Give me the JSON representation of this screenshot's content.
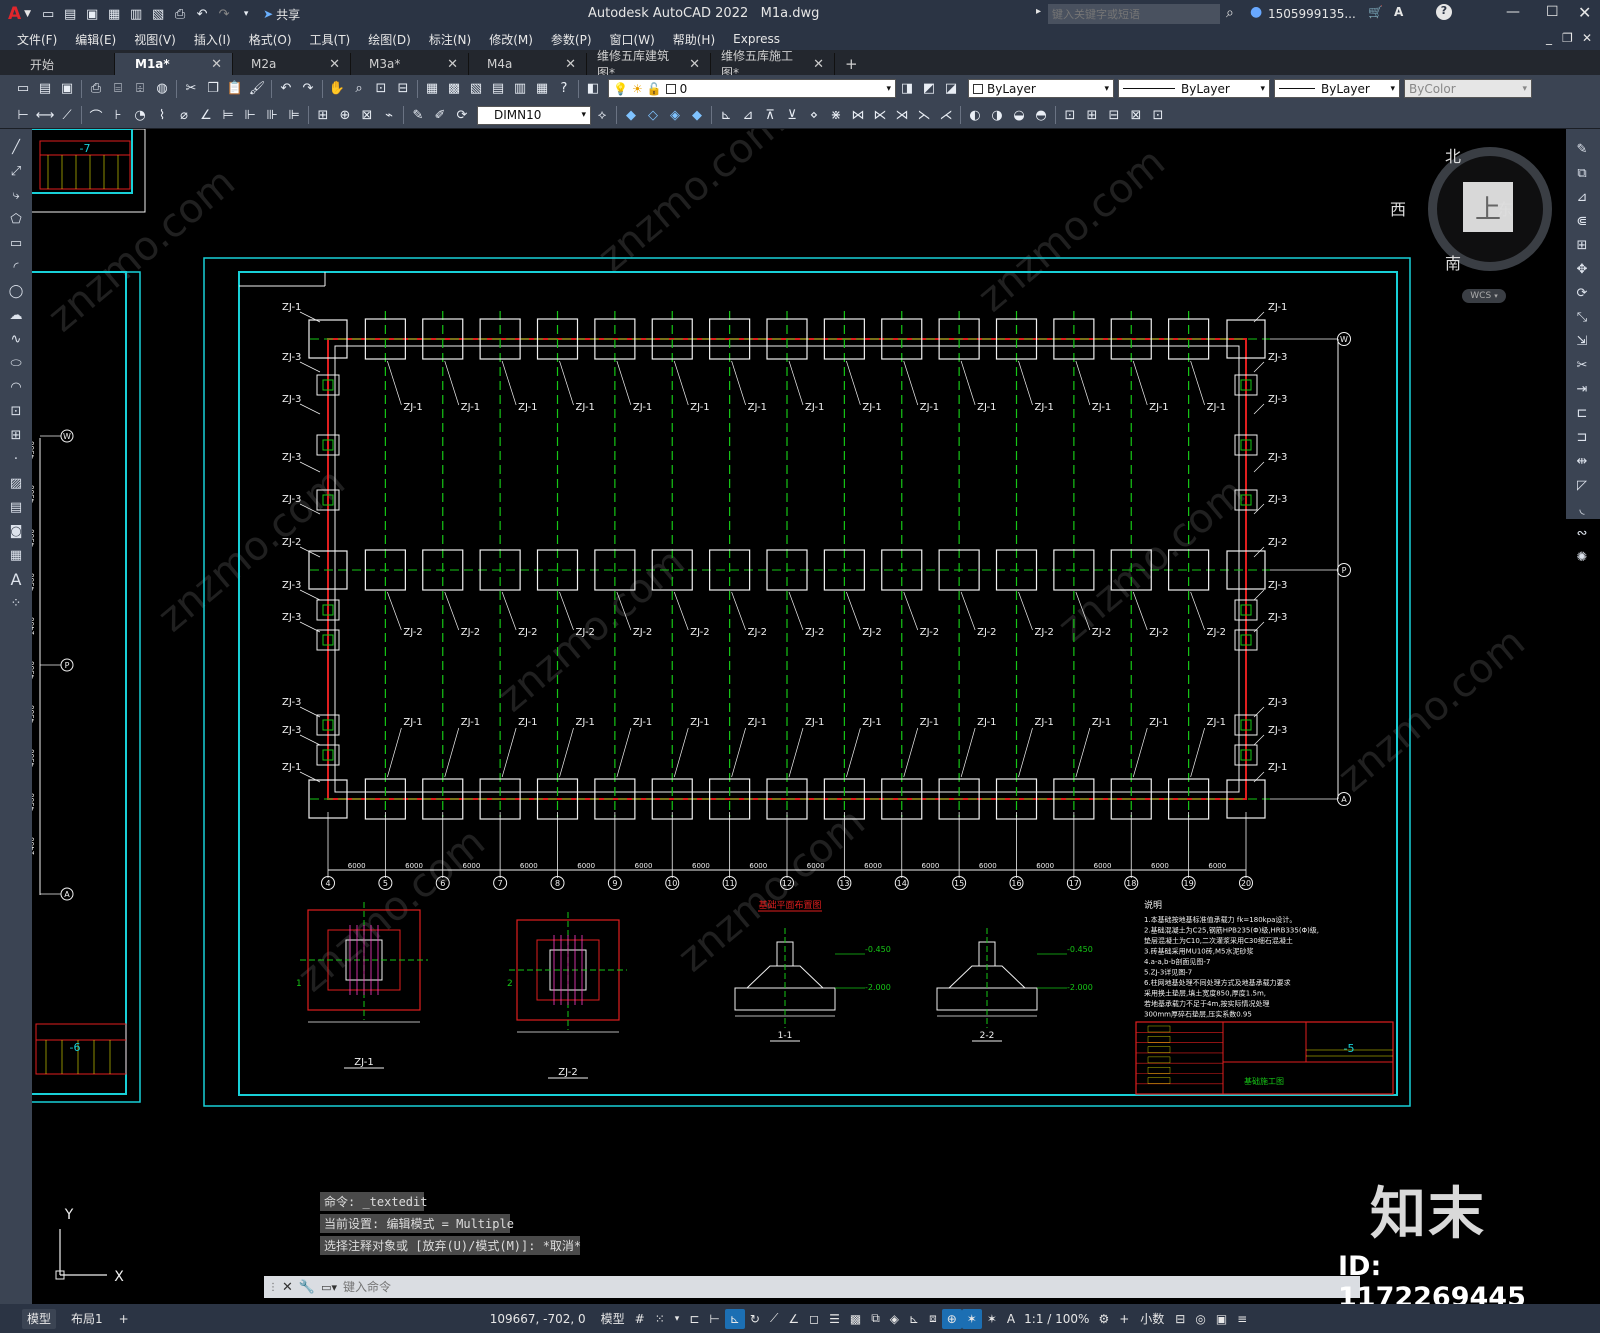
{
  "title": {
    "app": "Autodesk AutoCAD 2022",
    "file": "M1a.dwg",
    "search_placeholder": "键入关键字或短语",
    "user": "1505999135...",
    "share": "共享"
  },
  "menu": [
    "文件(F)",
    "编辑(E)",
    "视图(V)",
    "插入(I)",
    "格式(O)",
    "工具(T)",
    "绘图(D)",
    "标注(N)",
    "修改(M)",
    "参数(P)",
    "窗口(W)",
    "帮助(H)",
    "Express"
  ],
  "tabs": [
    {
      "label": "开始",
      "active": false,
      "closable": false
    },
    {
      "label": "M1a*",
      "active": true,
      "closable": true
    },
    {
      "label": "M2a",
      "active": false,
      "closable": true
    },
    {
      "label": "M3a*",
      "active": false,
      "closable": true
    },
    {
      "label": "M4a",
      "active": false,
      "closable": true
    },
    {
      "label": "维修五库建筑图*",
      "active": false,
      "closable": true
    },
    {
      "label": "维修五库施工图*",
      "active": false,
      "closable": true
    }
  ],
  "layer": {
    "current": "0",
    "color": "ByLayer",
    "linetype": "ByLayer",
    "lineweight": "ByLayer",
    "plotstyle": "ByColor",
    "dimstyle": "DIMN10"
  },
  "viewcube": {
    "north": "北",
    "south": "南",
    "east": "东",
    "west": "西",
    "face": "上",
    "wcs": "WCS"
  },
  "drawing": {
    "top_labels": [
      "ZJ-1",
      "ZJ-1",
      "ZJ-1",
      "ZJ-1",
      "ZJ-1",
      "ZJ-1",
      "ZJ-1",
      "ZJ-1",
      "ZJ-1",
      "ZJ-1",
      "ZJ-1",
      "ZJ-1",
      "ZJ-1",
      "ZJ-1",
      "ZJ-1"
    ],
    "mid_labels": [
      "ZJ-2",
      "ZJ-2",
      "ZJ-2",
      "ZJ-2",
      "ZJ-2",
      "ZJ-2",
      "ZJ-2",
      "ZJ-2",
      "ZJ-2",
      "ZJ-2",
      "ZJ-2",
      "ZJ-2",
      "ZJ-2",
      "ZJ-2",
      "ZJ-2"
    ],
    "axis_numbers": [
      "4",
      "5",
      "6",
      "7",
      "8",
      "9",
      "10",
      "11",
      "12",
      "13",
      "14",
      "15",
      "16",
      "17",
      "18",
      "19",
      "20"
    ],
    "row_axes": [
      "W",
      "P",
      "A"
    ],
    "bay": "6000",
    "left_side_labels": [
      "ZJ-1",
      "ZJ-3",
      "ZJ-3",
      "ZJ-3",
      "ZJ-3",
      "ZJ-2",
      "ZJ-3",
      "ZJ-3",
      "ZJ-3",
      "ZJ-3",
      "ZJ-1"
    ],
    "plan_title": "基础平面布置图",
    "detail_titles": [
      "ZJ-1",
      "ZJ-2",
      "1-1",
      "2-2"
    ],
    "elev_high": "-0.450",
    "elev_low": "-2.000",
    "notes_title": "说明",
    "notes": [
      "1.本基础按地基标准值承载力 fk=180kpa设计。",
      "2.基础混凝土为C25,钢筋HPB235(Φ)级,HRB335(Φ)级,",
      "垫层混凝土为C10,二次灌浆采用C30细石混凝土",
      "3.砖基础采用MU10砖,M5水泥砂浆",
      "4.a-a,b-b剖面见图-7",
      "5.ZJ-3详见图-7",
      "6.柱网地基处理不同处理方式及地基承载力要求",
      "采用换土垫层,填土宽度850,厚度1.5m,",
      "若地基承载力不足于4m,按实际情况处理",
      "300mm厚碎石垫层,压实系数0.95"
    ],
    "titleblock_num": "-5",
    "titleblock_name": "基础施工图",
    "left_sheet_num_top": "-7",
    "left_sheet_num_bottom": "-6"
  },
  "command": {
    "history": [
      "命令: _textedit",
      "当前设置: 编辑模式 = Multiple",
      "选择注释对象或 [放弃(U)/模式(M)]: *取消*"
    ],
    "placeholder": "键入命令"
  },
  "status": {
    "coords": "109667, -702, 0",
    "space": "模型",
    "scale": "1:1 / 100%",
    "units": "小数",
    "layout_tabs": [
      "模型",
      "布局1"
    ]
  },
  "watermark": {
    "brand": "知末",
    "id": "ID: 1172269445",
    "site": "znzmo.com"
  },
  "colors": {
    "cyan": "#18d0d8",
    "red": "#e01e1e",
    "green": "#16c616",
    "white": "#f0f0f0",
    "yellow": "#e8e800",
    "magenta": "#ff3cc8",
    "accent": "#1c6fb3"
  }
}
